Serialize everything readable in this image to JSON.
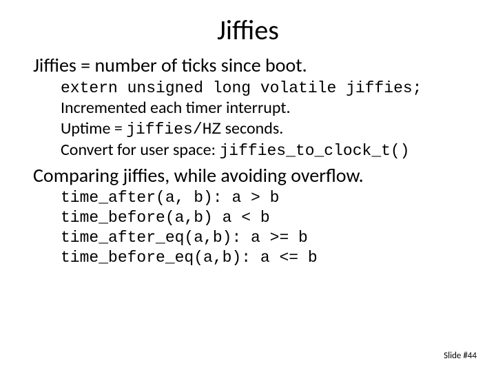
{
  "title": "Jiffies",
  "section1": {
    "heading": "Jiffies = number of ticks since boot.",
    "code1": "extern unsigned long volatile jiffies;",
    "line1": "Incremented each timer interrupt.",
    "line2_pre": "Uptime = ",
    "line2_code": "jiffies/HZ",
    "line2_post": " seconds.",
    "line3_pre": "Convert for user space: ",
    "line3_code": "jiffies_to_clock_t()"
  },
  "section2": {
    "heading": "Comparing jiffies, while avoiding overflow.",
    "c1": "time_after(a, b): a > b",
    "c2": "time_before(a,b) a < b",
    "c3": "time_after_eq(a,b): a >= b",
    "c4": "time_before_eq(a,b): a <= b"
  },
  "footer": "Slide #44"
}
